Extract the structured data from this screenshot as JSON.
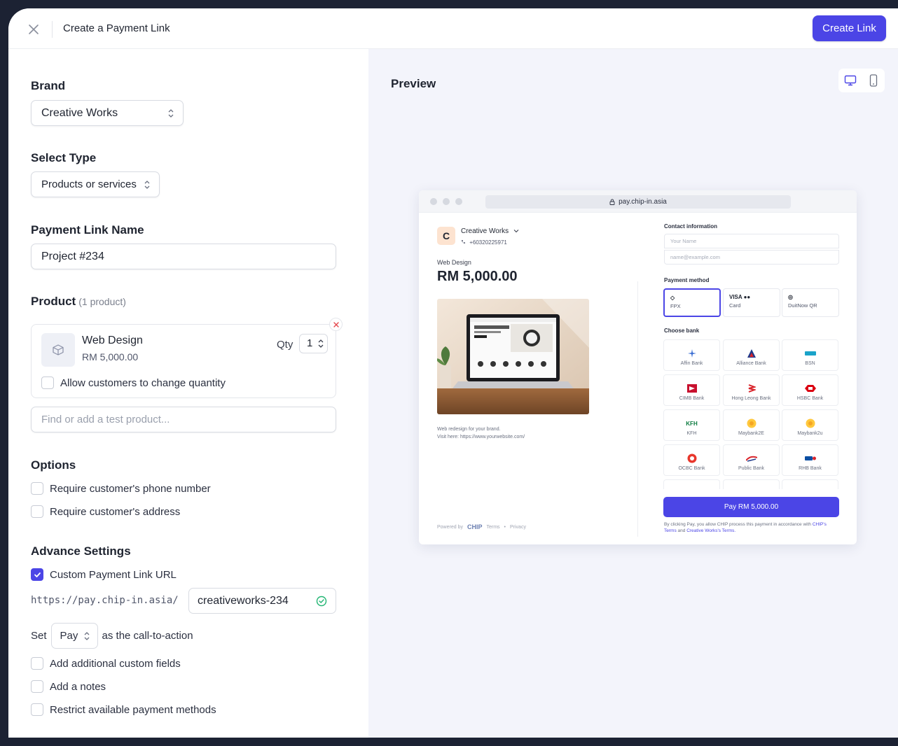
{
  "topbar": {
    "title": "Create a Payment Link",
    "create_label": "Create Link"
  },
  "brand": {
    "label": "Brand",
    "value": "Creative Works"
  },
  "type": {
    "label": "Select Type",
    "value": "Products or services"
  },
  "link_name": {
    "label": "Payment Link Name",
    "value": "Project #234"
  },
  "product": {
    "label": "Product",
    "count": "(1 product)",
    "item": {
      "name": "Web Design",
      "price": "RM 5,000.00",
      "qty_label": "Qty",
      "qty": "1"
    },
    "allow_qty_label": "Allow customers to change quantity",
    "search_placeholder": "Find or add a test product..."
  },
  "options": {
    "label": "Options",
    "phone": "Require customer's phone number",
    "address": "Require customer's address"
  },
  "advance": {
    "label": "Advance Settings",
    "custom_url_label": "Custom Payment Link URL",
    "url_prefix": "https://pay.chip-in.asia/",
    "slug": "creativeworks-234",
    "cta_prefix": "Set",
    "cta_value": "Pay",
    "cta_suffix": "as the call-to-action",
    "custom_fields": "Add additional custom fields",
    "notes": "Add a notes",
    "restrict": "Restrict available payment methods"
  },
  "preview": {
    "title": "Preview",
    "url": "pay.chip-in.asia",
    "brand_initial": "C",
    "brand": "Creative Works",
    "phone": "+60320225971",
    "product_name": "Web Design",
    "price": "RM 5,000.00",
    "desc_line1": "Web redesign for your brand.",
    "desc_line2": "Visit here: https://www.yourwebsite.com/",
    "powered_by": "Powered by",
    "chip": "CHIP",
    "terms": "Terms",
    "privacy": "Privacy",
    "contact_heading": "Contact information",
    "name_placeholder": "Your Name",
    "email_placeholder": "name@example.com",
    "payment_heading": "Payment method",
    "methods": [
      {
        "icon": "◇",
        "label": "FPX"
      },
      {
        "icon": "VISA ●●",
        "label": "Card"
      },
      {
        "icon": "◎",
        "label": "DuitNow QR"
      }
    ],
    "bank_heading": "Choose bank",
    "banks": [
      "Affin Bank",
      "Alliance Bank",
      "BSN",
      "CIMB Bank",
      "Hong Leong Bank",
      "HSBC Bank",
      "KFH",
      "Maybank2E",
      "Maybank2u",
      "OCBC Bank",
      "Public Bank",
      "RHB Bank"
    ],
    "bank_kfh_mark": "KFH",
    "pay_label": "Pay RM 5,000.00",
    "terms_text_a": "By clicking Pay, you allow",
    "terms_chip": "CHIP",
    "terms_text_b": "process this payment in accordance with",
    "terms_link1": "CHIP's Terms",
    "terms_and": "and",
    "terms_link2": "Creative Works's Terms."
  },
  "colors": {
    "accent": "#4b45e6",
    "panel_bg": "#f3f4fb",
    "outer_bg": "#1c2233"
  }
}
